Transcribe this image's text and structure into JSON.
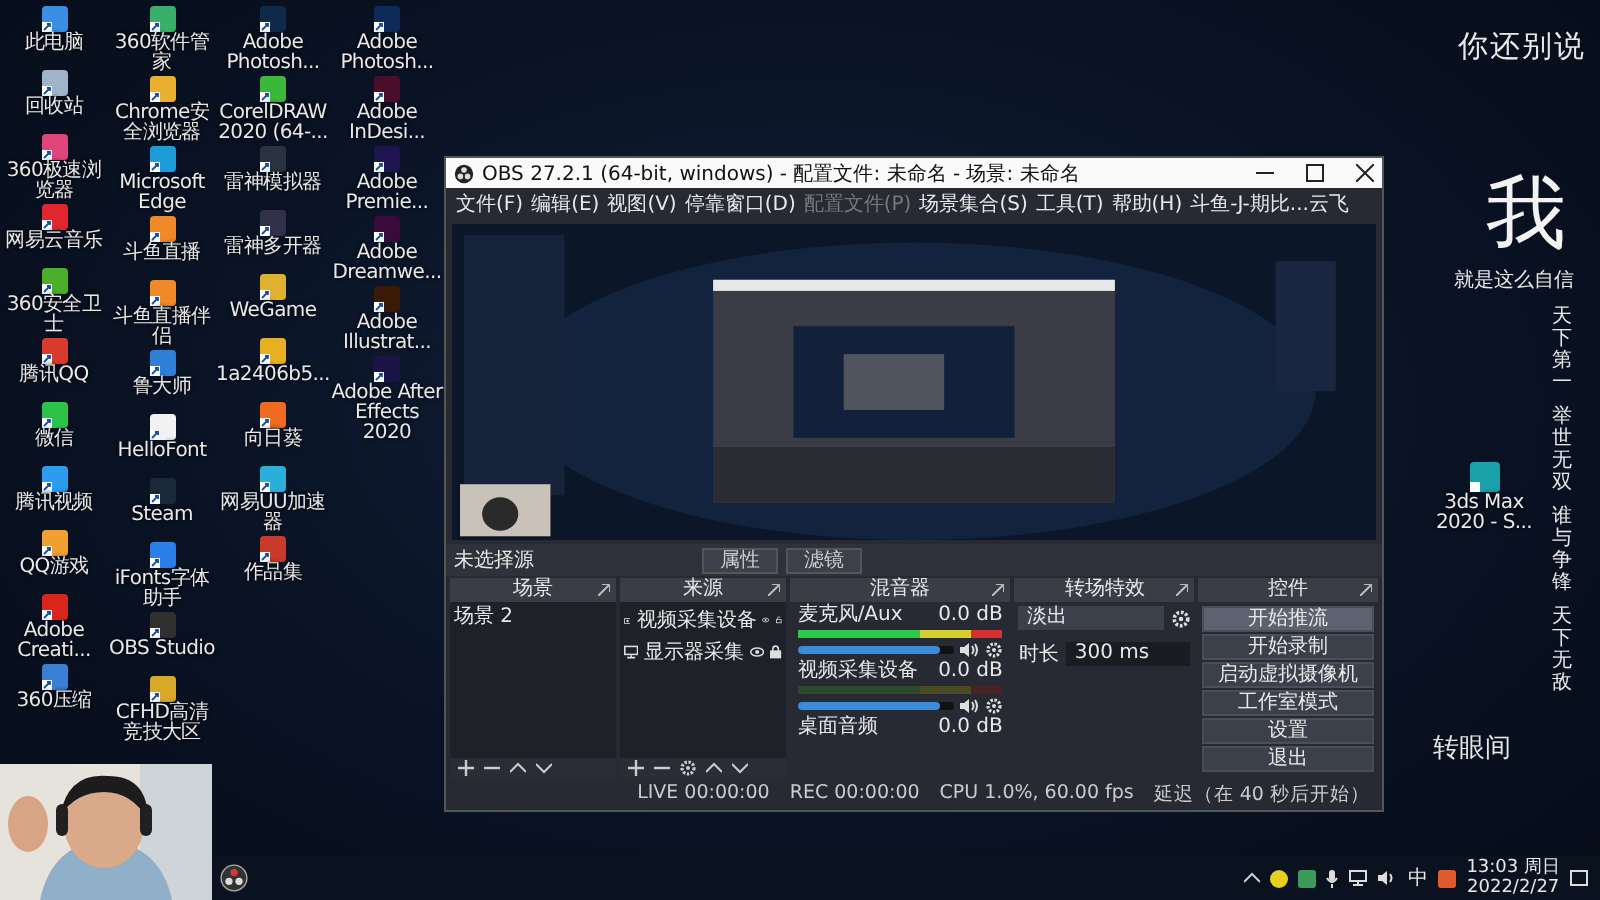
{
  "desktop_columns": [
    [
      {
        "label": "此电脑",
        "color": "#3a8ee6"
      },
      {
        "label": "回收站",
        "color": "#9fb4c8"
      },
      {
        "label": "360极速浏览器",
        "color": "#e0457b"
      },
      {
        "label": "网易云音乐",
        "color": "#e0262f"
      },
      {
        "label": "360安全卫士",
        "color": "#4caf2a"
      },
      {
        "label": "腾讯QQ",
        "color": "#d93a2b"
      },
      {
        "label": "微信",
        "color": "#2dc24a"
      },
      {
        "label": "腾讯视频",
        "color": "#2b9cf0"
      },
      {
        "label": "QQ游戏",
        "color": "#f0a030"
      },
      {
        "label": "Adobe Creati...",
        "color": "#d9261c"
      },
      {
        "label": "360压缩",
        "color": "#3b7fd4"
      }
    ],
    [
      {
        "label": "360软件管家",
        "color": "#39b06a"
      },
      {
        "label": "Chrome安全浏览器",
        "color": "#e8b030"
      },
      {
        "label": "Microsoft Edge",
        "color": "#1e9bd8"
      },
      {
        "label": "斗鱼直播",
        "color": "#f08a28"
      },
      {
        "label": "斗鱼直播伴侣",
        "color": "#f08a28"
      },
      {
        "label": "鲁大师",
        "color": "#2f7fd8"
      },
      {
        "label": "HelloFont",
        "color": "#f2f2f2"
      },
      {
        "label": "Steam",
        "color": "#1b2838"
      },
      {
        "label": "iFonts字体助手",
        "color": "#2a7fe8"
      },
      {
        "label": "OBS Studio",
        "color": "#303030"
      },
      {
        "label": "CFHD高清竞技大区",
        "color": "#d8a828"
      }
    ],
    [
      {
        "label": "Adobe Photosh...",
        "color": "#0e2a48"
      },
      {
        "label": "CorelDRAW 2020 (64-...",
        "color": "#3ab83a"
      },
      {
        "label": "雷神模拟器",
        "color": "#2a3440"
      },
      {
        "label": "雷神多开器",
        "color": "#33304a"
      },
      {
        "label": "WeGame",
        "color": "#e0b030"
      },
      {
        "label": "1a2406b5...",
        "color": "#e8b020"
      },
      {
        "label": "向日葵",
        "color": "#f06a20"
      },
      {
        "label": "网易UU加速器",
        "color": "#2ab0d8"
      },
      {
        "label": "作品集",
        "color": "#c83a2a"
      }
    ],
    [
      {
        "label": "Adobe Photosh...",
        "color": "#0e2a58"
      },
      {
        "label": "Adobe InDesi...",
        "color": "#4a0d2a"
      },
      {
        "label": "Adobe Premie...",
        "color": "#1e1450"
      },
      {
        "label": "Adobe Dreamwe...",
        "color": "#3a0a3a"
      },
      {
        "label": "Adobe Illustrat...",
        "color": "#3a1a06"
      },
      {
        "label": "Adobe After Effects 2020",
        "color": "#1a1448"
      }
    ]
  ],
  "obs": {
    "title": "OBS 27.2.1 (64-bit, windows) - 配置文件: 未命名 - 场景: 未命名",
    "menu": [
      {
        "label": "文件(F)",
        "disabled": false
      },
      {
        "label": "编辑(E)",
        "disabled": false
      },
      {
        "label": "视图(V)",
        "disabled": false
      },
      {
        "label": "停靠窗口(D)",
        "disabled": false
      },
      {
        "label": "配置文件(P)",
        "disabled": true
      },
      {
        "label": "场景集合(S)",
        "disabled": false
      },
      {
        "label": "工具(T)",
        "disabled": false
      },
      {
        "label": "帮助(H)",
        "disabled": false
      },
      {
        "label": "斗鱼-J-期比...云飞",
        "disabled": false
      }
    ],
    "preview": {
      "kind": "picture"
    },
    "selection_label": "未选择源",
    "source_buttons": [
      "属性",
      "滤镜"
    ],
    "scenes": {
      "title": "场景",
      "items": [
        "场景 2"
      ]
    },
    "sources": {
      "title": "来源",
      "items": [
        {
          "label": "视频采集设备",
          "kind": "camera",
          "visible": true,
          "locked": false
        },
        {
          "label": "显示器采集",
          "kind": "monitor",
          "visible": true,
          "locked": true
        }
      ]
    },
    "mixer": {
      "title": "混音器",
      "channels": [
        {
          "name": "麦克风/Aux",
          "reading": "0.0 dB",
          "active": true,
          "level": 0.9
        },
        {
          "name": "视频采集设备",
          "reading": "0.0 dB",
          "active": false,
          "level": 0.9
        },
        {
          "name": "桌面音频",
          "reading": "0.0 dB"
        }
      ]
    },
    "transitions": {
      "title": "转场特效",
      "type": "淡出",
      "duration_label": "时长",
      "duration": "300 ms"
    },
    "controls": {
      "title": "控件",
      "buttons": [
        {
          "label": "开始推流",
          "hovered": true
        },
        {
          "label": "开始录制",
          "hovered": false
        },
        {
          "label": "启动虚拟摄像机",
          "hovered": false
        },
        {
          "label": "工作室模式",
          "hovered": false
        },
        {
          "label": "设置",
          "hovered": false
        },
        {
          "label": "退出",
          "hovered": false
        }
      ]
    },
    "status": {
      "live": "LIVE 00:00:00",
      "rec": "REC 00:00:00",
      "cpu": "CPU 1.0%, 60.00 fps",
      "delay": "延迟（在 40 秒后开始）"
    }
  },
  "wallpaper": {
    "heading": "你还别说",
    "big_char": "我",
    "tagline": "就是这么自信",
    "vertical": [
      "天下第一",
      "举世无双",
      "谁与争锋",
      "天下无敌"
    ],
    "footer": "转眼间"
  },
  "side_icon": {
    "label": "3ds Max 2020 - S..."
  },
  "webcam": {
    "kind": "picture"
  },
  "taskbar": {
    "ime": "中",
    "time": "13:03 周日",
    "date": "2022/2/27"
  }
}
